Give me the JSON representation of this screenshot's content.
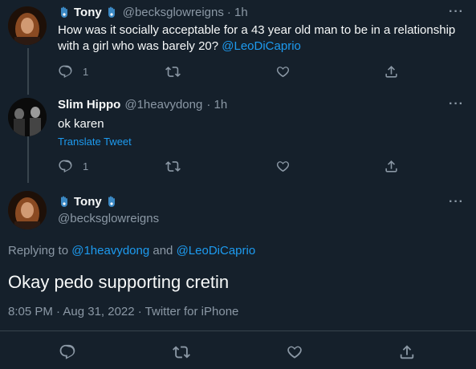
{
  "tweet1": {
    "name": "Tony",
    "handle": "@becksglowreigns",
    "time": "· 1h",
    "text": "How was it socially acceptable for a 43 year old man to be in a relationship with a girl who was barely 20? ",
    "mention": "@LeoDiCaprio",
    "reply_count": "1"
  },
  "tweet2": {
    "name": "Slim Hippo",
    "handle": "@1heavydong",
    "time": "· 1h",
    "text": "ok karen",
    "translate": "Translate Tweet",
    "reply_count": "1"
  },
  "tweet3": {
    "name": "Tony",
    "handle": "@becksglowreigns",
    "replying_prefix": "Replying to ",
    "replying_user1": "@1heavydong",
    "replying_and": " and ",
    "replying_user2": "@LeoDiCaprio",
    "text": "Okay pedo supporting cretin",
    "meta": "8:05 PM · Aug 31, 2022 · Twitter for iPhone"
  },
  "icons": {
    "more": "more-icon",
    "reply": "reply-icon",
    "retweet": "retweet-icon",
    "like": "like-icon",
    "share": "share-icon",
    "emoji": "hamsa-icon"
  },
  "colors": {
    "background": "#15202b",
    "link": "#1d9bf0",
    "muted": "#8b98a5",
    "text": "#f7f9f9"
  }
}
